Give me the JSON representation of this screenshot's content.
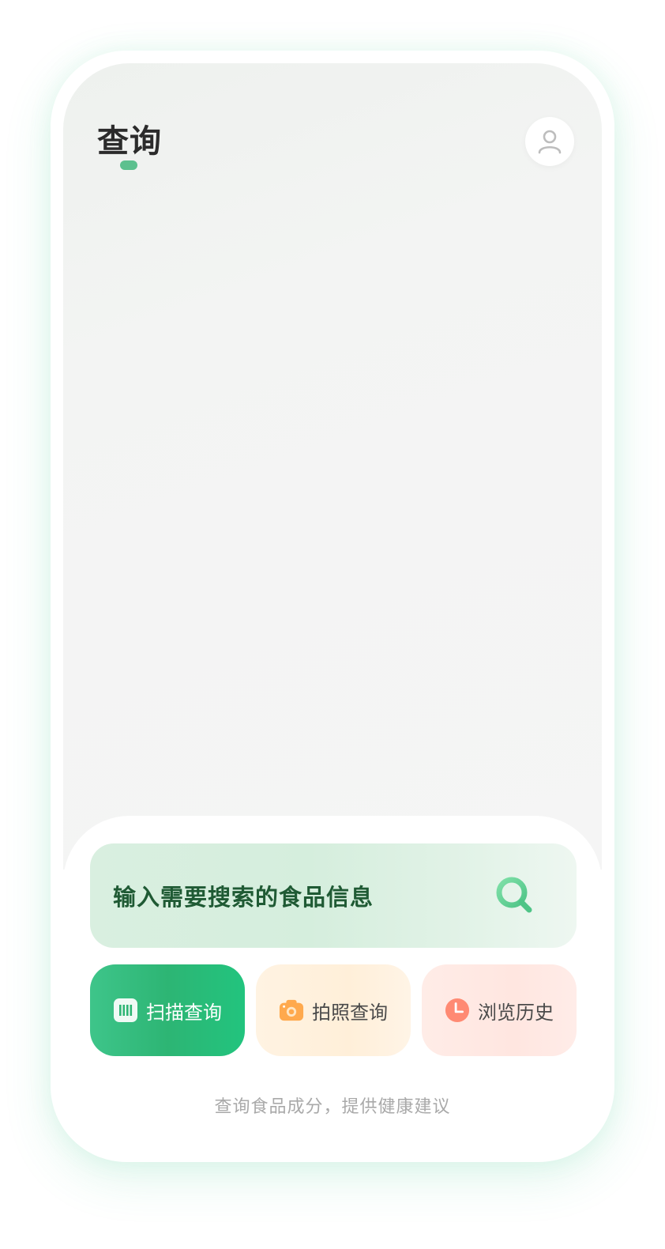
{
  "header": {
    "title": "查询"
  },
  "search": {
    "placeholder": "输入需要搜索的食品信息"
  },
  "actions": [
    {
      "label": "扫描查询",
      "icon": "barcode-icon"
    },
    {
      "label": "拍照查询",
      "icon": "camera-icon"
    },
    {
      "label": "浏览历史",
      "icon": "clock-icon"
    }
  ],
  "footer": {
    "text": "查询食品成分，提供健康建议"
  },
  "colors": {
    "accent": "#5cc08e",
    "scan_button": "#2db574",
    "photo_icon": "#ffa94d",
    "history_icon": "#ff8a73",
    "search_text": "#1f5a34"
  }
}
